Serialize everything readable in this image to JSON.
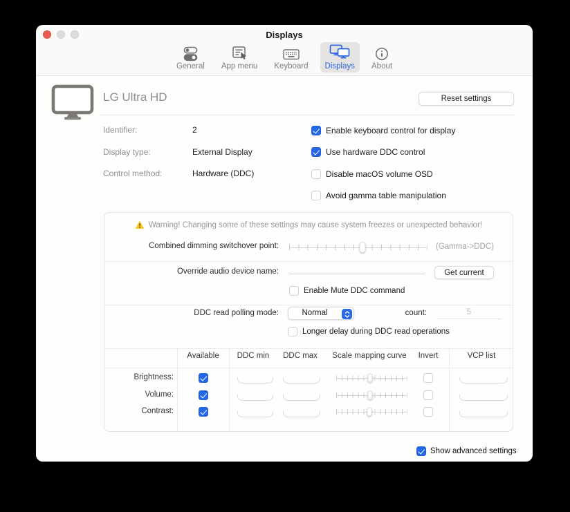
{
  "window": {
    "title": "Displays"
  },
  "toolbar": {
    "items": [
      {
        "label": "General",
        "selected": false
      },
      {
        "label": "App menu",
        "selected": false
      },
      {
        "label": "Keyboard",
        "selected": false
      },
      {
        "label": "Displays",
        "selected": true
      },
      {
        "label": "About",
        "selected": false
      }
    ]
  },
  "header": {
    "display_name": "LG Ultra HD",
    "reset_button_label": "Reset settings"
  },
  "info": {
    "rows": [
      {
        "label": "Identifier:",
        "value": "2"
      },
      {
        "label": "Display type:",
        "value": "External Display"
      },
      {
        "label": "Control method:",
        "value": "Hardware (DDC)"
      }
    ]
  },
  "options": {
    "items": [
      {
        "label": "Enable keyboard control for display",
        "checked": true
      },
      {
        "label": "Use hardware DDC control",
        "checked": true
      },
      {
        "label": "Disable macOS volume OSD",
        "checked": false
      },
      {
        "label": "Avoid gamma table manipulation",
        "checked": false
      }
    ]
  },
  "advanced": {
    "warning_text": "Warning! Changing some of these settings may cause system freezes or unexpected behavior!",
    "dimming": {
      "label": "Combined dimming switchover point:",
      "suffix": "(Gamma->DDC)",
      "thumb_percent": 53
    },
    "audio": {
      "label": "Override audio device name:",
      "value": "",
      "button_label": "Get current",
      "mute": {
        "label": "Enable Mute DDC command",
        "checked": false
      }
    },
    "polling": {
      "label": "DDC read polling mode:",
      "mode": "Normal",
      "count_label": "count:",
      "count_value": "5",
      "delay": {
        "label": "Longer delay during DDC read operations",
        "checked": false
      }
    },
    "table": {
      "headers": [
        "Available",
        "DDC min",
        "DDC max",
        "Scale mapping curve",
        "Invert",
        "VCP list"
      ],
      "rows": [
        {
          "label": "Brightness:",
          "available": true,
          "ddc_min": "",
          "ddc_max": "",
          "curve_thumb_percent": 48,
          "invert": false,
          "vcp_list": ""
        },
        {
          "label": "Volume:",
          "available": true,
          "ddc_min": "",
          "ddc_max": "",
          "curve_thumb_percent": 48,
          "invert": false,
          "vcp_list": ""
        },
        {
          "label": "Contrast:",
          "available": true,
          "ddc_min": "",
          "ddc_max": "",
          "curve_thumb_percent": 47,
          "invert": false,
          "vcp_list": ""
        }
      ]
    }
  },
  "footer": {
    "show_advanced": {
      "label": "Show advanced settings",
      "checked": true
    }
  },
  "colors": {
    "accent_blue": "#2a67e4",
    "checkbox_blue": "#2467e2",
    "warning_yellow": "#f7c527",
    "close_red": "#ee5b50"
  }
}
